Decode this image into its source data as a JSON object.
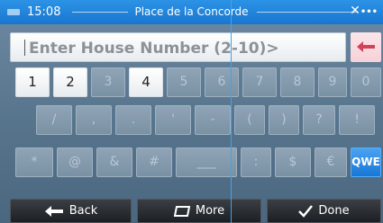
{
  "status": {
    "time": "15:08",
    "title": "Place de la Concorde",
    "right_icon": "gps-x-icon"
  },
  "input": {
    "placeholder": "Enter House Number (2-10)>"
  },
  "keyboard": {
    "row1": [
      "1",
      "2",
      "3",
      "4",
      "5",
      "6",
      "7",
      "8",
      "9",
      "0"
    ],
    "row1_enabled": [
      true,
      true,
      false,
      true,
      false,
      false,
      false,
      false,
      false,
      false
    ],
    "row2": [
      "/",
      ",",
      ".",
      "'",
      "-",
      "(",
      ")",
      "?",
      "!"
    ],
    "row3": [
      "*",
      "@",
      "&",
      "#",
      "___",
      ":",
      "$",
      "€"
    ],
    "mode_key": "QWE"
  },
  "nav": {
    "back": "Back",
    "more": "More",
    "done": "Done"
  },
  "colors": {
    "accent": "#1976cf",
    "backspace_arrow": "#d1435b"
  }
}
